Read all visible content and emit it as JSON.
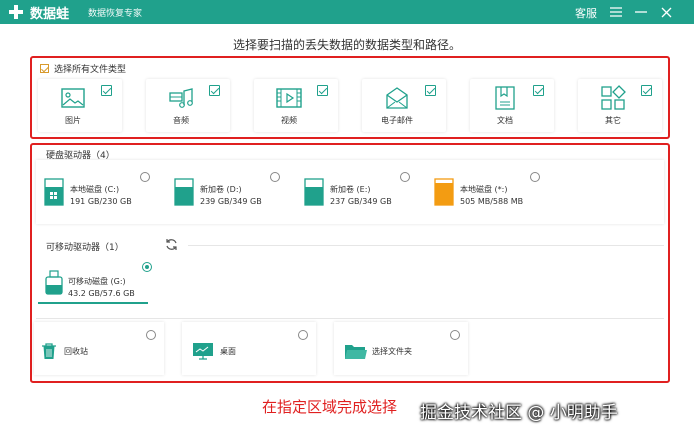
{
  "titlebar": {
    "app_name": "数据蛙",
    "app_sub": "数据恢复专家",
    "service": "客服",
    "bg_color": "#20a18c"
  },
  "prompt": "选择要扫描的丢失数据的数据类型和路径。",
  "file_types": {
    "select_all_label": "选择所有文件类型",
    "items": [
      {
        "label": "图片",
        "icon": "image-icon",
        "checked": true
      },
      {
        "label": "音频",
        "icon": "audio-icon",
        "checked": true
      },
      {
        "label": "视频",
        "icon": "video-icon",
        "checked": true
      },
      {
        "label": "电子邮件",
        "icon": "email-icon",
        "checked": true
      },
      {
        "label": "文档",
        "icon": "document-icon",
        "checked": true
      },
      {
        "label": "其它",
        "icon": "other-icon",
        "checked": true
      }
    ]
  },
  "hard_drives": {
    "header": "硬盘驱动器（4）",
    "items": [
      {
        "name": "本地磁盘 (C:)",
        "size": "191 GB/230 GB",
        "icon": "windows-disk-icon",
        "selected": false
      },
      {
        "name": "新加卷 (D:)",
        "size": "239 GB/349 GB",
        "icon": "disk-icon",
        "selected": false
      },
      {
        "name": "新加卷 (E:)",
        "size": "237 GB/349 GB",
        "icon": "disk-icon",
        "selected": false
      },
      {
        "name": "本地磁盘 (*:)",
        "size": "505 MB/588 MB",
        "icon": "disk-orange-icon",
        "selected": false
      }
    ]
  },
  "removable": {
    "header": "可移动驱动器（1）",
    "items": [
      {
        "name": "可移动磁盘 (G:)",
        "size": "43.2 GB/57.6 GB",
        "icon": "usb-icon",
        "selected": true
      }
    ]
  },
  "locations": [
    {
      "label": "回收站",
      "icon": "trash-icon",
      "selected": false
    },
    {
      "label": "桌面",
      "icon": "desktop-icon",
      "selected": false
    },
    {
      "label": "选择文件夹",
      "icon": "folder-icon",
      "selected": false
    }
  ],
  "annotation": "在指定区域完成选择",
  "watermark": "掘金技术社区 @ 小明助手",
  "colors": {
    "accent": "#20a18c",
    "highlight": "#e02020",
    "orange": "#f39c12"
  }
}
